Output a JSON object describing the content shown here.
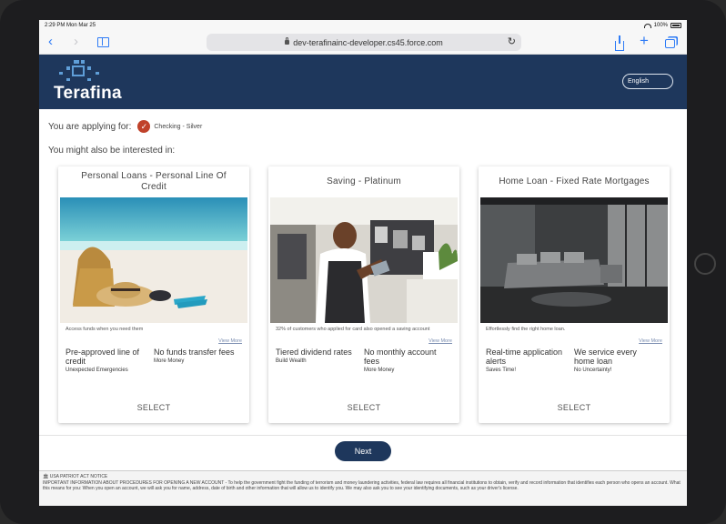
{
  "status": {
    "time": "2:29 PM  Mon Mar 25",
    "battery": "100%"
  },
  "browser": {
    "url": "dev-terafinainc-developer.cs45.force.com"
  },
  "header": {
    "logo_text": "Terafina",
    "language_label": "English"
  },
  "applying": {
    "label": "You are applying for:",
    "product": "Checking - Silver"
  },
  "interested_label": "You might also be interested in:",
  "cards": [
    {
      "title": "Personal Loans - Personal Line Of Credit",
      "description": "Access funds when you need them",
      "view_more": "View More",
      "features": [
        {
          "main": "Pre-approved line of credit",
          "sub": "Unexpected Emergencies"
        },
        {
          "main": "No funds transfer fees",
          "sub": "More Money"
        }
      ],
      "select_label": "SELECT"
    },
    {
      "title": "Saving - Platinum",
      "description": "32% of customers who applied for card also opened a saving account",
      "view_more": "View More",
      "features": [
        {
          "main": "Tiered dividend rates",
          "sub": "Build Wealth"
        },
        {
          "main": "No monthly account fees",
          "sub": "More Money"
        }
      ],
      "select_label": "SELECT"
    },
    {
      "title": "Home Loan - Fixed Rate Mortgages",
      "description": "Effortlessly find the right home loan.",
      "view_more": "View More",
      "features": [
        {
          "main": "Real-time application alerts",
          "sub": "Saves Time!"
        },
        {
          "main": "We service every home loan",
          "sub": "No Uncertainty!"
        }
      ],
      "select_label": "SELECT"
    }
  ],
  "next_label": "Next",
  "footer": {
    "heading": "🏛 USA PATRIOT ACT NOTICE",
    "text": "IMPORTANT INFORMATION ABOUT PROCEDURES FOR OPENING A NEW ACCOUNT - To help the government fight the funding of terrorism and money laundering activities, federal law requires all financial institutions to obtain, verify and record information that identifies each person who opens an account. What this means for you: When you open an account, we will ask you for name, address, date of birth and other information that will allow us to identify you. We may also ask you to see your identifying documents, such as your driver's license."
  },
  "colors": {
    "header": "#1e375c",
    "accent": "#c0422a",
    "link": "#2f7cf6"
  }
}
